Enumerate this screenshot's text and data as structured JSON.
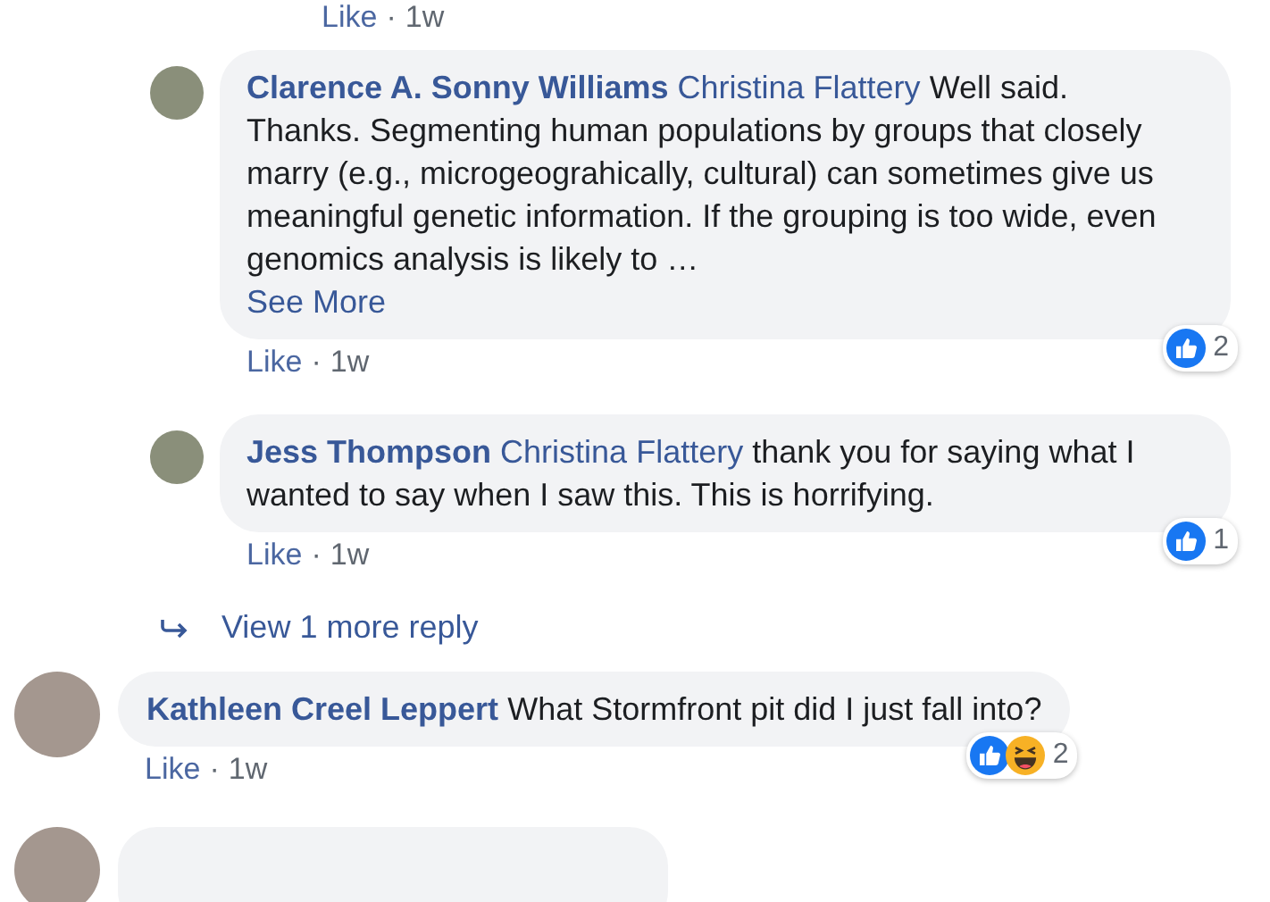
{
  "separator": "·",
  "previous_actions": {
    "like": "Like",
    "time": "1w"
  },
  "replies": [
    {
      "author": "Clarence A. Sonny Williams",
      "mention": "Christina Flattery",
      "text": "Well said. Thanks. Segmenting human populations by groups that closely marry (e.g., microgeograhically, cultural) can sometimes give us meaningful genetic information. If the grouping is too wide, even genomics analysis is likely to …",
      "see_more": "See More",
      "like": "Like",
      "time": "1w",
      "reactions": [
        {
          "kind": "like"
        }
      ],
      "reaction_count": "2"
    },
    {
      "author": "Jess Thompson",
      "mention": "Christina Flattery",
      "text": "thank you for saying what I wanted to say when I saw this. This is horrifying.",
      "like": "Like",
      "time": "1w",
      "reactions": [
        {
          "kind": "like"
        }
      ],
      "reaction_count": "1"
    }
  ],
  "view_more": "View 1 more reply",
  "comments": [
    {
      "author": "Kathleen Creel Leppert",
      "text": "What Stormfront pit did I just fall into?",
      "like": "Like",
      "time": "1w",
      "reactions": [
        {
          "kind": "like"
        },
        {
          "kind": "haha"
        }
      ],
      "reaction_count": "2"
    }
  ]
}
